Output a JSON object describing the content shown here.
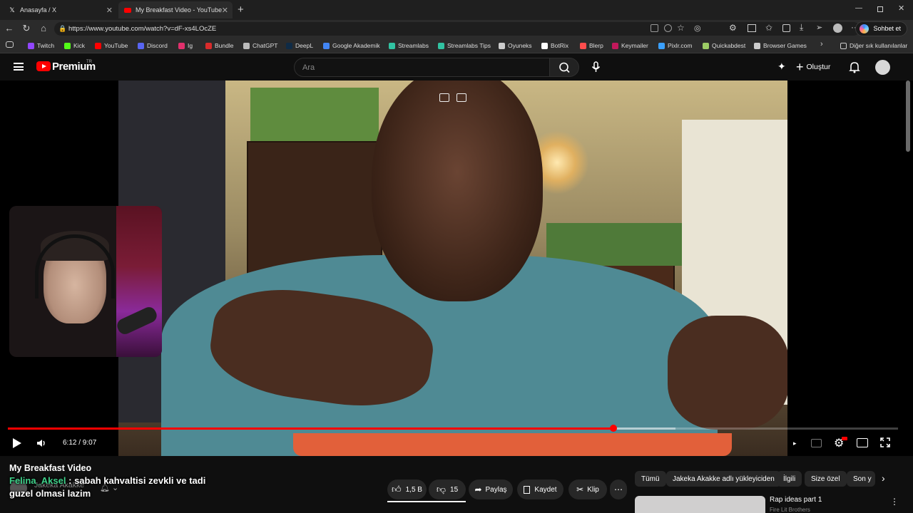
{
  "browser": {
    "tabs": [
      {
        "label": "Anasayfa / X",
        "active": false
      },
      {
        "label": "My Breakfast Video - YouTube",
        "active": true
      }
    ],
    "url": "https://www.youtube.com/watch?v=dF-xs4LOcZE",
    "chat_button": "Sohbet et",
    "bookmarks": [
      {
        "label": "Twitch",
        "color": "#9146ff"
      },
      {
        "label": "Kick",
        "color": "#53fc18"
      },
      {
        "label": "YouTube",
        "color": "#ff0000"
      },
      {
        "label": "Discord",
        "color": "#5865f2"
      },
      {
        "label": "Ig",
        "color": "#e1306c"
      },
      {
        "label": "Bundle",
        "color": "#d92b2b"
      },
      {
        "label": "ChatGPT",
        "color": "#bbbbbb"
      },
      {
        "label": "DeepL",
        "color": "#0f2b46"
      },
      {
        "label": "Google Akademik",
        "color": "#4285f4"
      },
      {
        "label": "Streamlabs",
        "color": "#31c3a2"
      },
      {
        "label": "Streamlabs Tips",
        "color": "#31c3a2"
      },
      {
        "label": "Oyuneks",
        "color": "#cccccc"
      },
      {
        "label": "BotRix",
        "color": "#ffffff"
      },
      {
        "label": "Blerp",
        "color": "#ff4d4d"
      },
      {
        "label": "Keymailer",
        "color": "#c2185b"
      },
      {
        "label": "Pixlr.com",
        "color": "#3aa0ff"
      },
      {
        "label": "Quickabdest",
        "color": "#9ccc65"
      },
      {
        "label": "Browser Games",
        "color": "#cccccc"
      }
    ],
    "other_bookmarks": "Diğer sık kullanılanlar"
  },
  "youtube": {
    "brand": "Premium",
    "region": "TR",
    "search_placeholder": "Ara",
    "create_label": "Oluştur"
  },
  "player": {
    "current_time": "6:12",
    "duration": "9:07",
    "time_display": "6:12 / 9:07",
    "progress_fraction": 0.68,
    "buffered_fraction": 0.75
  },
  "video": {
    "title": "My Breakfast Video",
    "channel": "Jakeka Akakke",
    "likes": "1,5 B",
    "dislikes": "15",
    "share": "Paylaş",
    "save": "Kaydet",
    "clip": "Klip"
  },
  "chat_overlay": {
    "username": "Felina_Aksel",
    "separator": " : ",
    "message": "sabah kahvaltisi zevkli ve tadi guzel olmasi lazim"
  },
  "filter_chips": [
    "Tümü",
    "Jakeka Akakke adlı yükleyiciden",
    "İlgili",
    "Size özel",
    "Son y"
  ],
  "recommended": {
    "title": "Rap ideas part 1",
    "subtitle": "Fire Lit Brothers"
  }
}
